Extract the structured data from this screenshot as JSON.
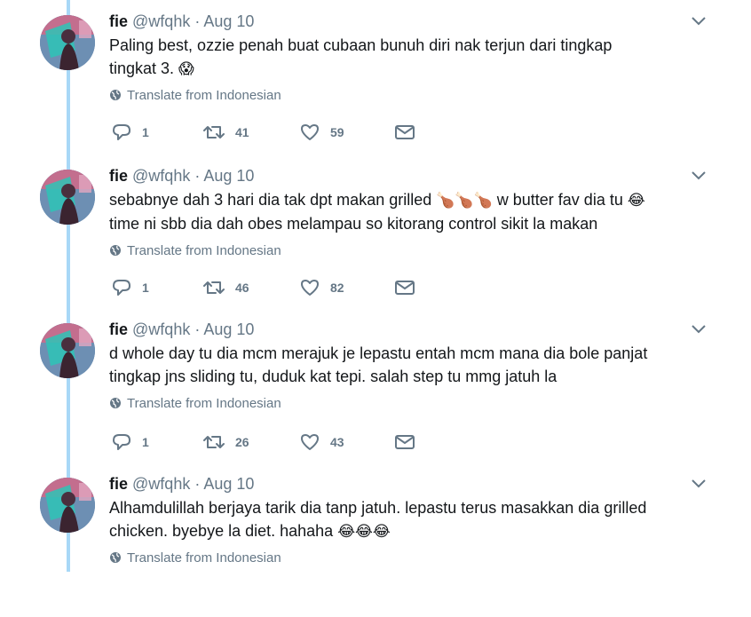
{
  "tweets": [
    {
      "name": "fie",
      "handle": "@wfqhk",
      "date": "Aug 10",
      "text_parts": [
        "Paling best, ozzie penah buat cubaan bunuh diri nak terjun dari tingkap tingkat 3. ",
        ""
      ],
      "emojis": [
        "😱"
      ],
      "translate_label": "Translate from Indonesian",
      "replies": "1",
      "retweets": "41",
      "likes": "59"
    },
    {
      "name": "fie",
      "handle": "@wfqhk",
      "date": "Aug 10",
      "text_parts": [
        "sebabnye dah 3 hari dia tak dpt makan grilled ",
        " w butter fav dia tu ",
        " time ni sbb dia dah obes melampau so kitorang control sikit la makan"
      ],
      "emojis": [
        "🍗🍗🍗",
        "😂"
      ],
      "translate_label": "Translate from Indonesian",
      "replies": "1",
      "retweets": "46",
      "likes": "82"
    },
    {
      "name": "fie",
      "handle": "@wfqhk",
      "date": "Aug 10",
      "text_parts": [
        "d whole day tu dia mcm merajuk je lepastu entah mcm mana dia bole panjat tingkap jns sliding tu, duduk kat tepi. salah step tu mmg jatuh la"
      ],
      "emojis": [],
      "translate_label": "Translate from Indonesian",
      "replies": "1",
      "retweets": "26",
      "likes": "43"
    },
    {
      "name": "fie",
      "handle": "@wfqhk",
      "date": "Aug 10",
      "text_parts": [
        "Alhamdulillah berjaya tarik dia tanp jatuh. lepastu terus masakkan dia grilled chicken. byebye la diet. hahaha ",
        ""
      ],
      "emojis": [
        "😂😂😂"
      ],
      "translate_label": "Translate from Indonesian"
    }
  ],
  "separator": "·",
  "colors": {
    "thread_line": "#a8d8f7",
    "secondary_text": "#657786",
    "primary_text": "#14171a"
  },
  "icons": [
    "globe-icon",
    "reply-icon",
    "retweet-icon",
    "like-icon",
    "direct-message-icon",
    "chevron-down-icon"
  ]
}
